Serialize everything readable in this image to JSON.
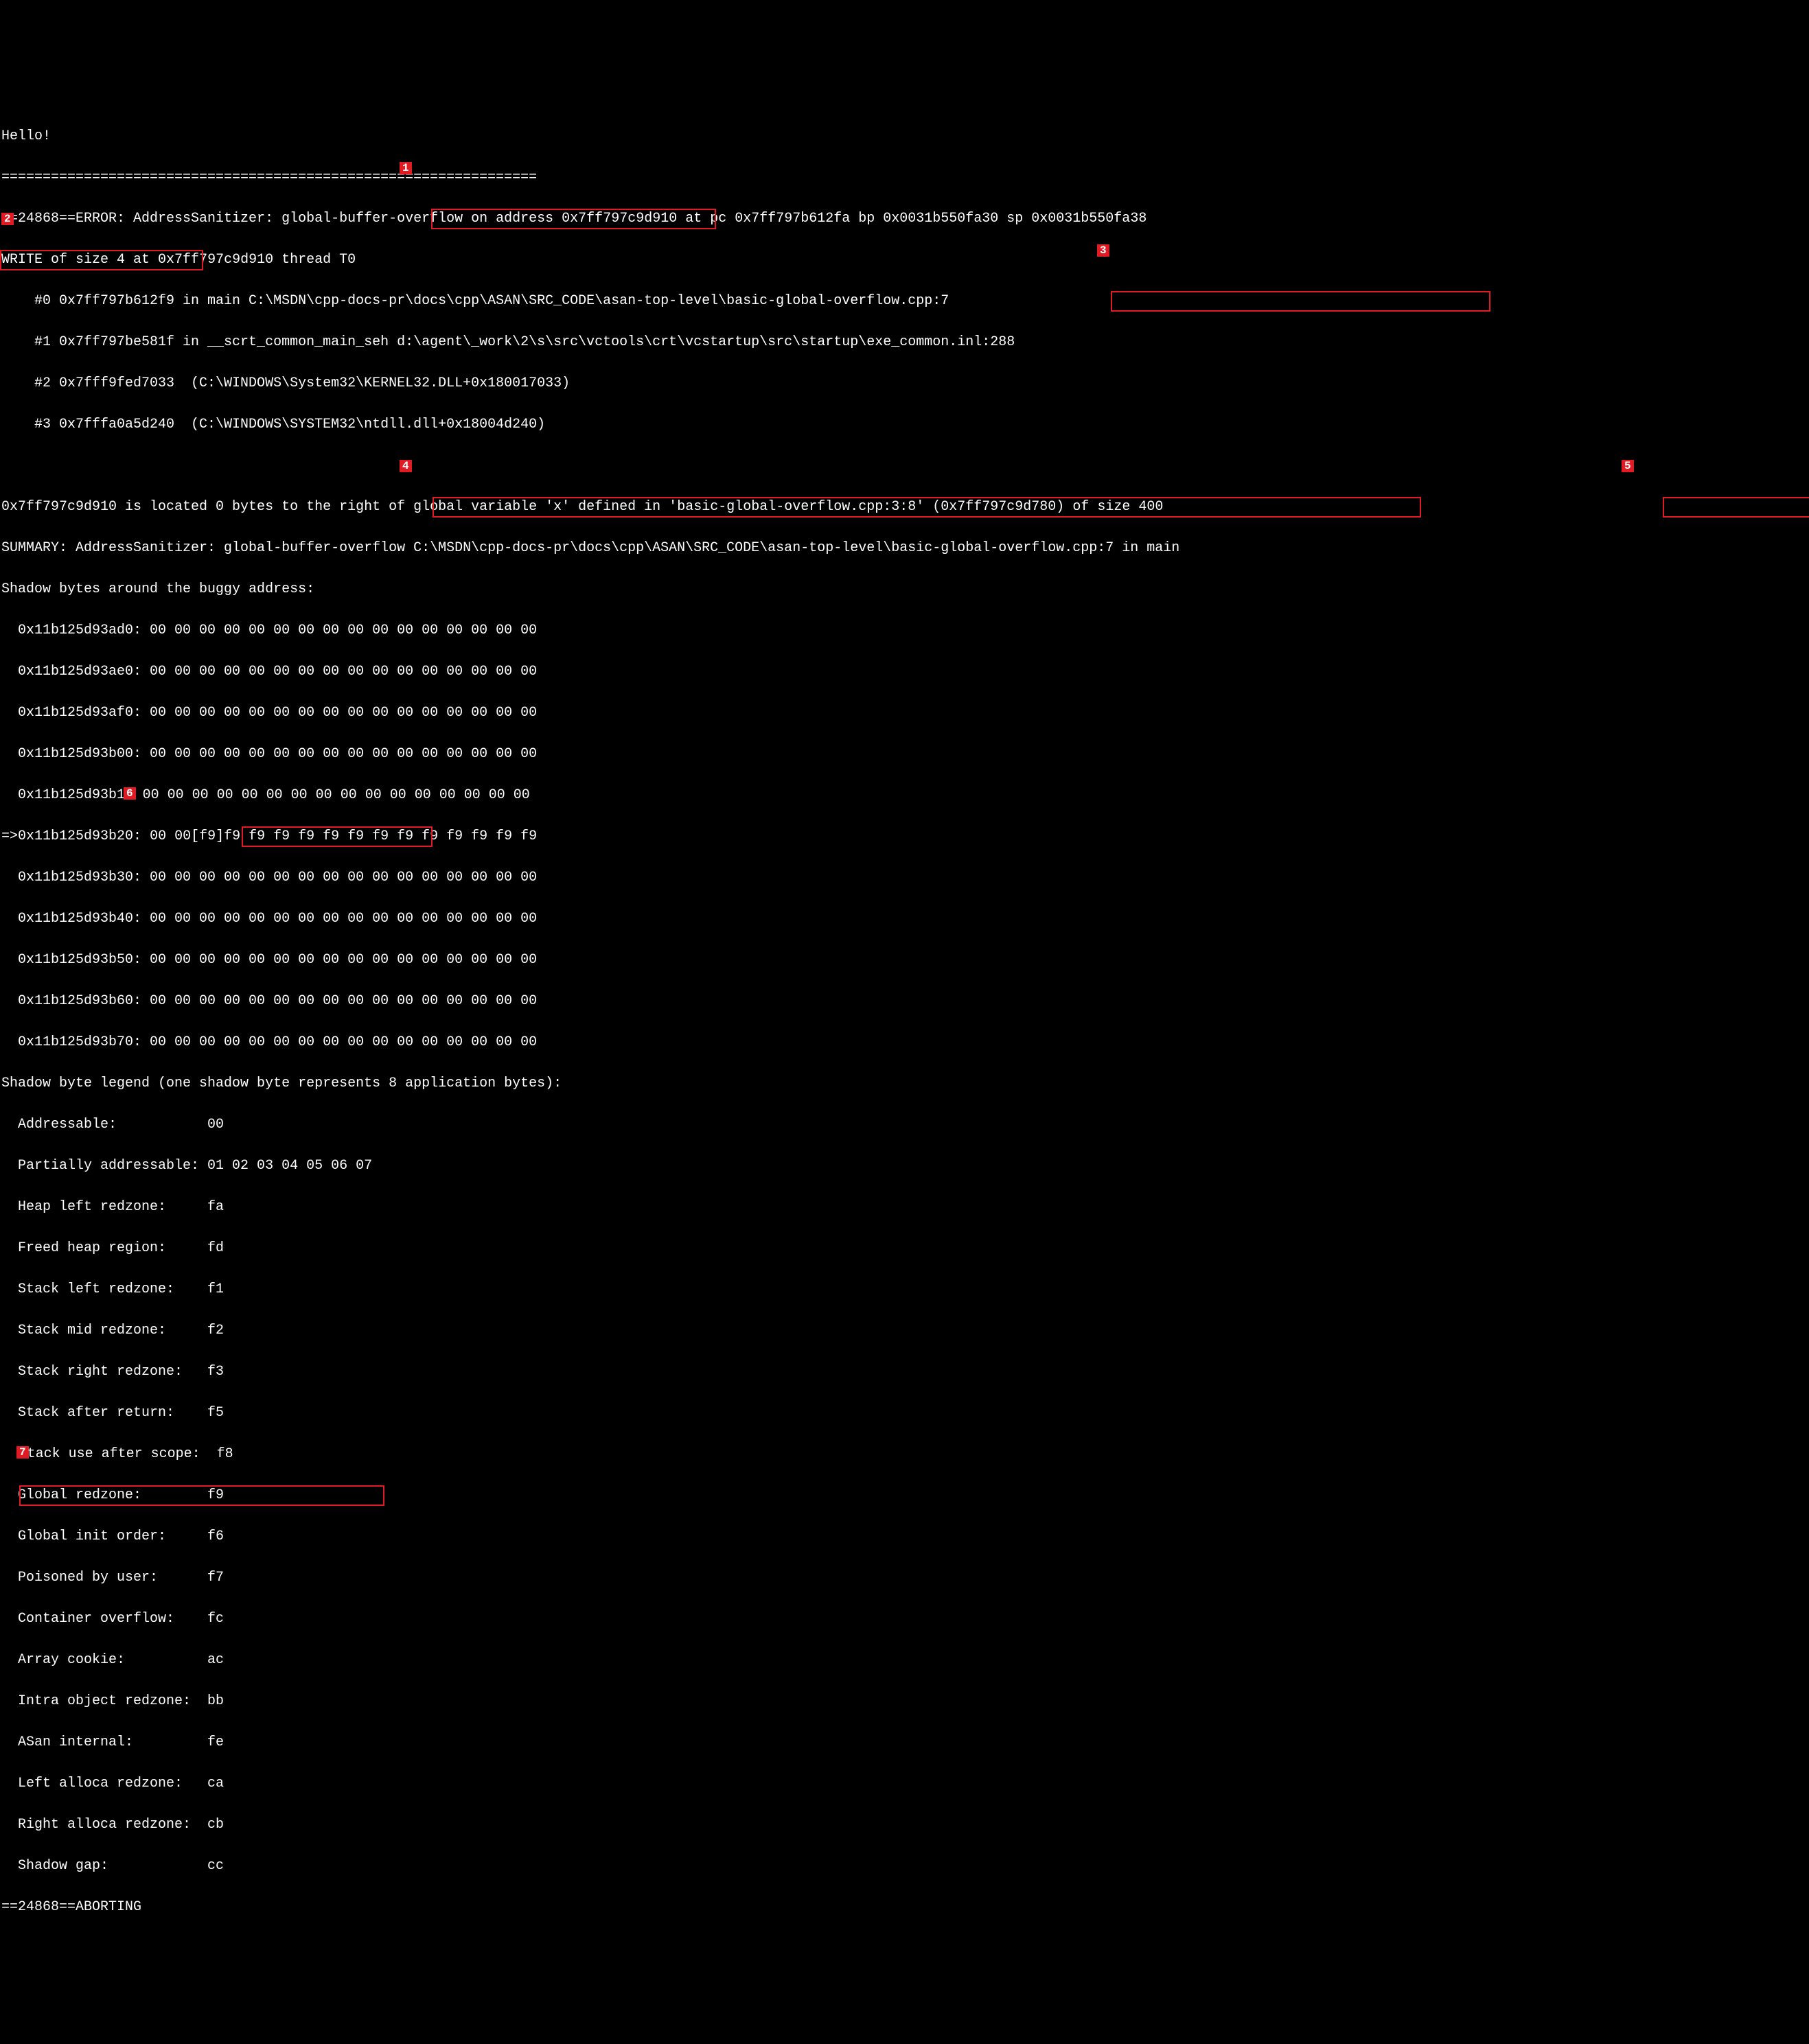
{
  "greeting": "Hello!",
  "separator": "=================================================================",
  "error": {
    "prefix": "==24868==ERROR: AddressSanitizer:",
    "type": "global-buffer-overflow",
    "mid1": "on address 0x7ff797c9d910 at pc 0x7ff797b612fa bp 0x0031b550fa30 sp 0x0031b550fa38",
    "write_prefix": "WRITE of size 4",
    "write_suffix": "at 0x7ff797c9d910 thread T0"
  },
  "stack": [
    "    #0 0x7ff797b612f9 in main C:\\MSDN\\cpp-docs-pr\\docs\\cpp\\ASAN\\SRC_CODE\\asan-top-level\\basic-global-overflow.cpp:7",
    "    #1 0x7ff797be581f in __scrt_common_main_seh d:\\agent\\_work\\2\\s\\src\\vctools\\crt\\vcstartup\\src\\startup\\exe_common.inl:288",
    "    #2 0x7fff9fed7033  (C:\\WINDOWS\\System32\\KERNEL32.DLL+0x180017033)",
    "    #3 0x7fffa0a5d240  (C:\\WINDOWS\\SYSTEM32\\ntdll.dll+0x18004d240)"
  ],
  "location": {
    "prefix": "0x7ff797c9d910 is located 0 bytes",
    "mid": "to the right of global variable 'x' defined in 'basic-global-overflow.cpp:3:8'",
    "addr": "(0x7ff797c9d780)",
    "size": "of size 400"
  },
  "summary": "SUMMARY: AddressSanitizer: global-buffer-overflow C:\\MSDN\\cpp-docs-pr\\docs\\cpp\\ASAN\\SRC_CODE\\asan-top-level\\basic-global-overflow.cpp:7 in main",
  "shadow_header": "Shadow bytes around the buggy address:",
  "shadow": {
    "rows": [
      "  0x11b125d93ad0: 00 00 00 00 00 00 00 00 00 00 00 00 00 00 00 00",
      "  0x11b125d93ae0: 00 00 00 00 00 00 00 00 00 00 00 00 00 00 00 00",
      "  0x11b125d93af0: 00 00 00 00 00 00 00 00 00 00 00 00 00 00 00 00",
      "  0x11b125d93b00: 00 00 00 00 00 00 00 00 00 00 00 00 00 00 00 00"
    ],
    "row_b10_pre": "  0x11b125d93b1",
    "row_b10_post": " 00 00 00 00 00 00 00 00 00 00 00 00 00 00 00 00",
    "current_pre": "=>0x11b125d93b20:",
    "current_box": "00 00[f9]f9 f9",
    "current_post": "f9 f9 f9 f9 f9 f9 f9 f9 f9 f9 f9",
    "rows_after": [
      "  0x11b125d93b30: 00 00 00 00 00 00 00 00 00 00 00 00 00 00 00 00",
      "  0x11b125d93b40: 00 00 00 00 00 00 00 00 00 00 00 00 00 00 00 00",
      "  0x11b125d93b50: 00 00 00 00 00 00 00 00 00 00 00 00 00 00 00 00",
      "  0x11b125d93b60: 00 00 00 00 00 00 00 00 00 00 00 00 00 00 00 00",
      "  0x11b125d93b70: 00 00 00 00 00 00 00 00 00 00 00 00 00 00 00 00"
    ]
  },
  "legend_header": "Shadow byte legend (one shadow byte represents 8 application bytes):",
  "legend": [
    "  Addressable:           00",
    "  Partially addressable: 01 02 03 04 05 06 07",
    "  Heap left redzone:     fa",
    "  Freed heap region:     fd",
    "  Stack left redzone:    f1",
    "  Stack mid redzone:     f2",
    "  Stack right redzone:   f3",
    "  Stack after return:    f5"
  ],
  "legend_scope_pre": "  ",
  "legend_scope_post": "tack use after scope:  f8",
  "legend_global": "  Global redzone:        f9",
  "legend_after": [
    "  Global init order:     f6",
    "  Poisoned by user:      f7",
    "  Container overflow:    fc",
    "  Array cookie:          ac",
    "  Intra object redzone:  bb",
    "  ASan internal:         fe",
    "  Left alloca redzone:   ca",
    "  Right alloca redzone:  cb",
    "  Shadow gap:            cc"
  ],
  "aborting": "==24868==ABORTING",
  "callouts": {
    "1": "1",
    "2": "2",
    "3": "3",
    "4": "4",
    "5": "5",
    "6": "6",
    "7": "7"
  }
}
